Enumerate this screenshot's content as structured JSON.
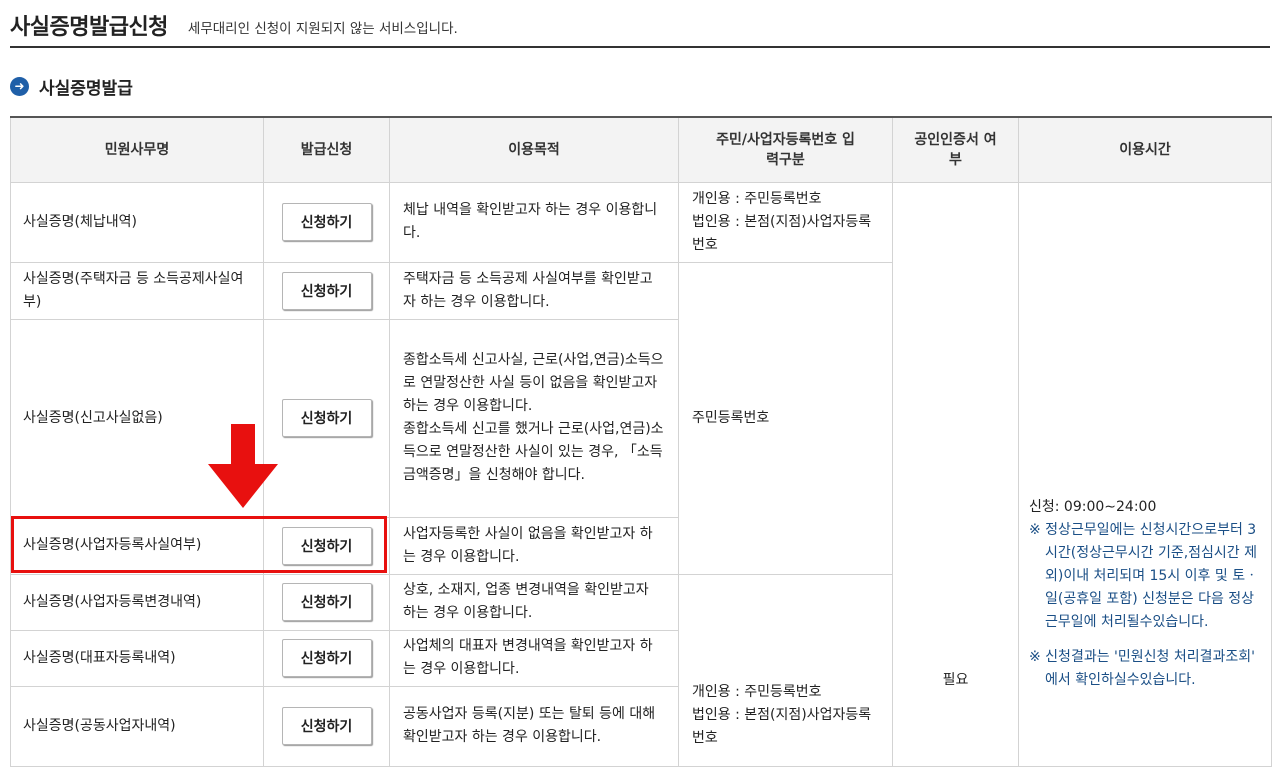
{
  "header": {
    "title": "사실증명발급신청",
    "subtitle": "세무대리인 신청이 지원되지 않는 서비스입니다."
  },
  "section": {
    "icon": "arrow-right-circle-icon",
    "title": "사실증명발급"
  },
  "table": {
    "columns": [
      "민원사무명",
      "발급신청",
      "이용목적",
      "주민/사업자등록번호 입력구분",
      "공인인증서 여부",
      "이용시간"
    ],
    "rows": [
      {
        "name": "사실증명(체납내역)",
        "button": "신청하기",
        "purpose": "체납 내역을 확인받고자 하는 경우 이용합니다."
      },
      {
        "name": "사실증명(주택자금 등 소득공제사실여부)",
        "button": "신청하기",
        "purpose": "주택자금 등 소득공제 사실여부를 확인받고자 하는 경우 이용합니다."
      },
      {
        "name": "사실증명(신고사실없음)",
        "button": "신청하기",
        "purpose": "종합소득세 신고사실, 근로(사업,연금)소득으로 연말정산한 사실 등이 없음을 확인받고자 하는 경우 이용합니다.",
        "purpose2": "종합소득세 신고를 했거나 근로(사업,연금)소득으로 연말정산한 사실이 있는 경우, 「소득금액증명」을 신청해야 합니다."
      },
      {
        "name": "사실증명(사업자등록사실여부)",
        "button": "신청하기",
        "purpose": "사업자등록한 사실이 없음을 확인받고자 하는 경우 이용합니다."
      },
      {
        "name": "사실증명(사업자등록변경내역)",
        "button": "신청하기",
        "purpose": "상호, 소재지, 업종 변경내역을 확인받고자 하는 경우 이용합니다."
      },
      {
        "name": "사실증명(대표자등록내역)",
        "button": "신청하기",
        "purpose": "사업체의 대표자 변경내역을 확인받고자 하는 경우 이용합니다."
      },
      {
        "name": "사실증명(공동사업자내역)",
        "button": "신청하기",
        "purpose": "공동사업자 등록(지분) 또는 탈퇴 등에 대해 확인받고자 하는 경우 이용합니다."
      }
    ],
    "id_types": {
      "group1": {
        "personal": "개인용 : 주민등록번호",
        "corporate": "법인용 : 본점(지점)사업자등록번호"
      },
      "group2": "주민등록번호",
      "group3": {
        "personal": "개인용 : 주민등록번호",
        "corporate": "법인용 : 본점(지점)사업자등록번호"
      }
    },
    "cert_required": "필요",
    "hours": {
      "apply": "신청: 09:00∼24:00",
      "note1": "※ 정상근무일에는 신청시간으로부터 3시간(정상근무시간 기준,점심시간 제외)이내 처리되며 15시 이후 및 토ㆍ일(공휴일 포함) 신청분은 다음 정상근무일에 처리될수있습니다.",
      "note2": "※ 신청결과는 '민원신청 처리결과조회' 에서 확인하실수있습니다."
    }
  },
  "annotation": {
    "arrow_icon": "red-down-arrow-icon",
    "highlight_color": "#e8100f"
  }
}
